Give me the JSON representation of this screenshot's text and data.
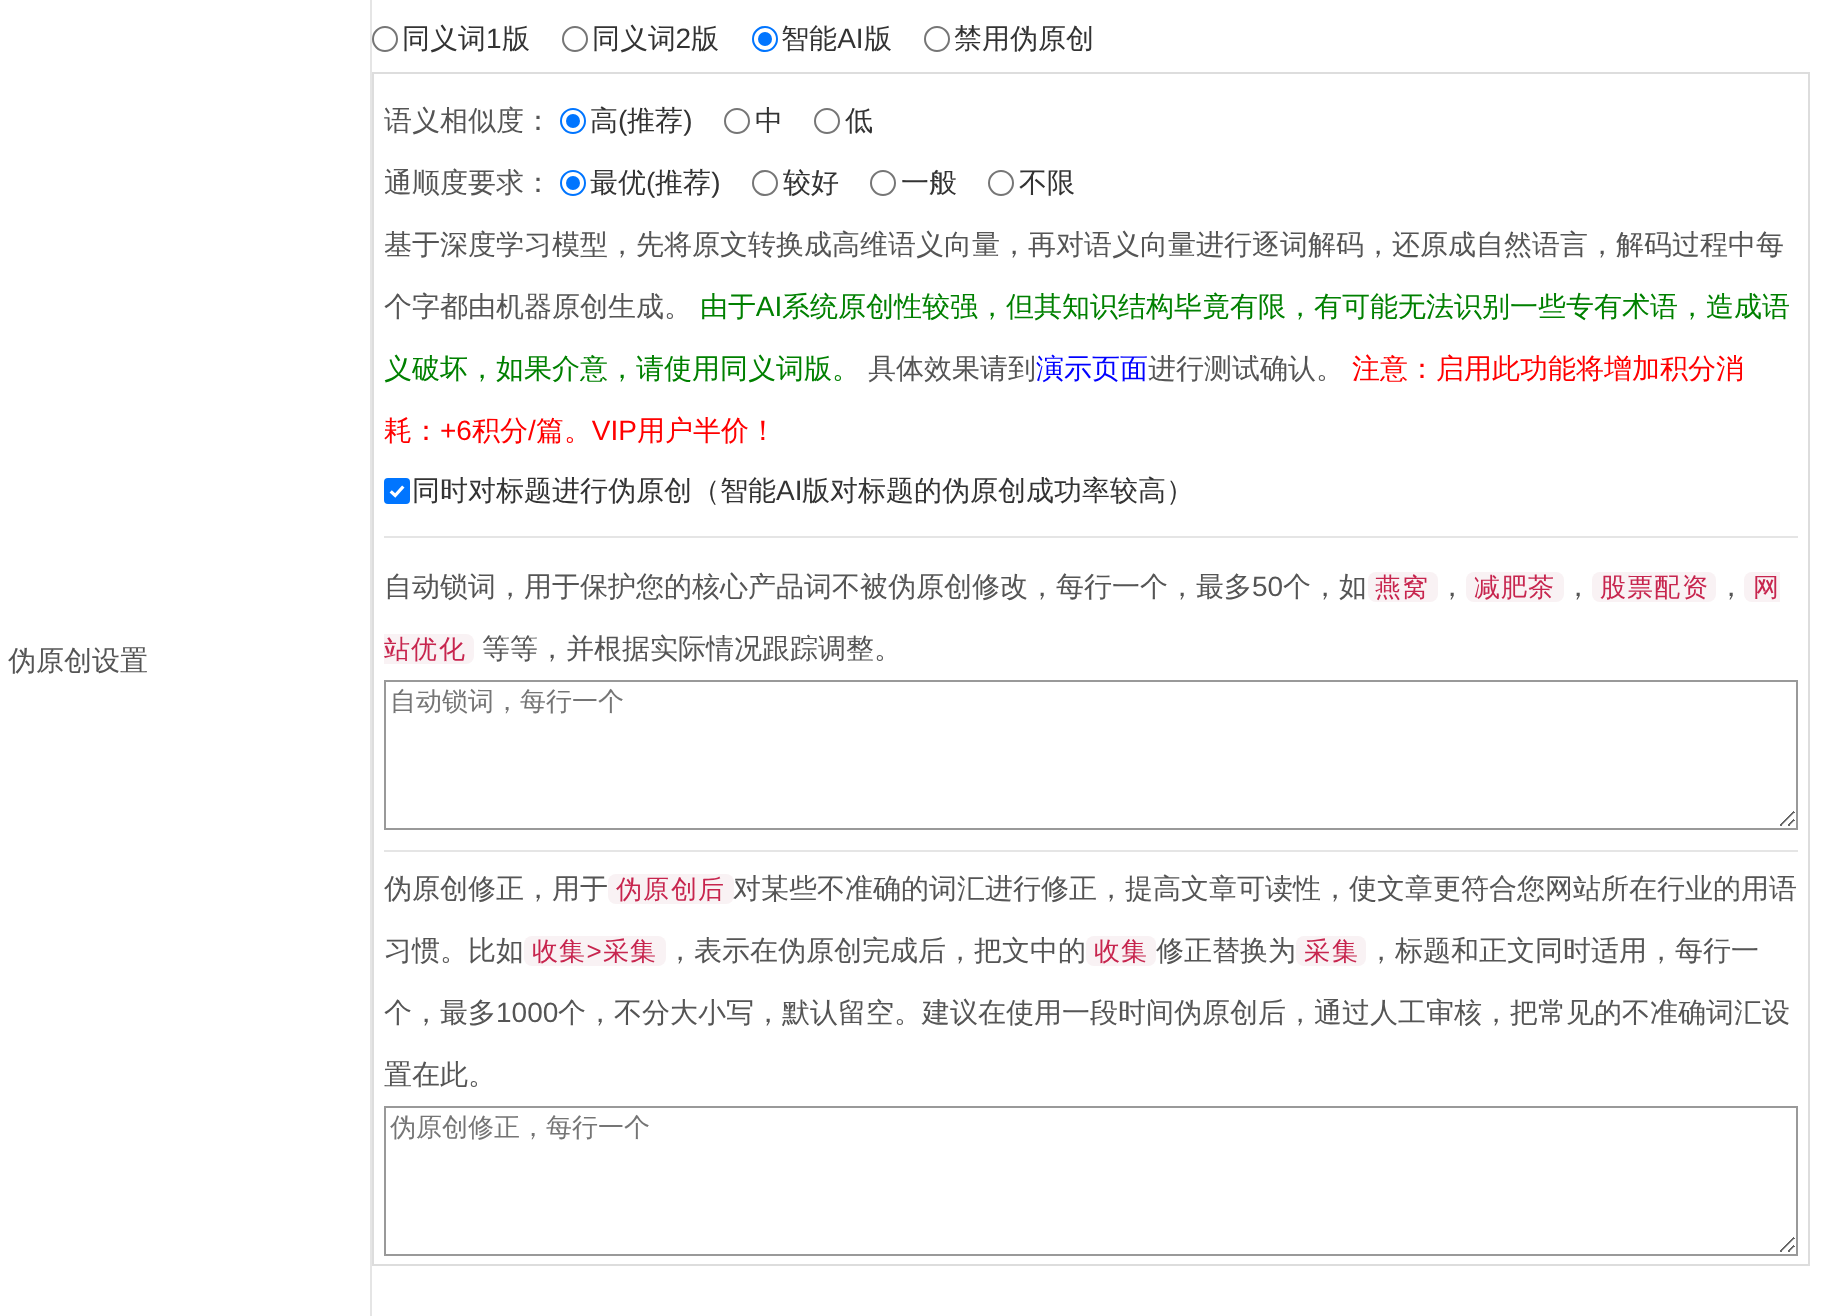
{
  "section_label": "伪原创设置",
  "modes": [
    {
      "label": "同义词1版",
      "selected": false
    },
    {
      "label": "同义词2版",
      "selected": false
    },
    {
      "label": "智能AI版",
      "selected": true
    },
    {
      "label": "禁用伪原创",
      "selected": false
    }
  ],
  "ai_panel": {
    "similarity": {
      "label": "语义相似度：",
      "options": [
        {
          "label": "高(推荐)",
          "selected": true
        },
        {
          "label": "中",
          "selected": false
        },
        {
          "label": "低",
          "selected": false
        }
      ]
    },
    "fluency": {
      "label": "通顺度要求：",
      "options": [
        {
          "label": "最优(推荐)",
          "selected": true
        },
        {
          "label": "较好",
          "selected": false
        },
        {
          "label": "一般",
          "selected": false
        },
        {
          "label": "不限",
          "selected": false
        }
      ]
    },
    "description": [
      {
        "kind": "text",
        "text": "基于深度学习模型，先将原文转换成高维语义向量，再对语义向量进行逐词解码，还原成自然语言，解码过程中每个字都由机器原创生成。 "
      },
      {
        "kind": "green",
        "text": "由于AI系统原创性较强，但其知识结构毕竟有限，有可能无法识别一些专有术语，造成语义破坏，如果介意，请使用同义词版。"
      },
      {
        "kind": "text",
        "text": " 具体效果请到"
      },
      {
        "kind": "link",
        "text": "演示页面"
      },
      {
        "kind": "text",
        "text": "进行测试确认。 "
      },
      {
        "kind": "red",
        "text": "注意：启用此功能将增加积分消耗：+6积分/篇。VIP用户半价！"
      }
    ],
    "title_rewrite": {
      "label": "同时对标题进行伪原创（智能AI版对标题的伪原创成功率较高）",
      "checked": true
    }
  },
  "lock_words": {
    "description": [
      {
        "kind": "text",
        "text": "自动锁词，用于保护您的核心产品词不被伪原创修改，每行一个，最多50个，如"
      },
      {
        "kind": "code",
        "text": "燕窝"
      },
      {
        "kind": "text",
        "text": "，"
      },
      {
        "kind": "code",
        "text": "减肥茶"
      },
      {
        "kind": "text",
        "text": "，"
      },
      {
        "kind": "code",
        "text": "股票配资"
      },
      {
        "kind": "text",
        "text": "，"
      },
      {
        "kind": "code",
        "text": "网站优化"
      },
      {
        "kind": "text",
        "text": " 等等，并根据实际情况跟踪调整。"
      }
    ],
    "placeholder": "自动锁词，每行一个"
  },
  "correction": {
    "description": [
      {
        "kind": "text",
        "text": "伪原创修正，用于"
      },
      {
        "kind": "code",
        "text": "伪原创后"
      },
      {
        "kind": "text",
        "text": "对某些不准确的词汇进行修正，提高文章可读性，使文章更符合您网站所在行业的用语习惯。比如"
      },
      {
        "kind": "code",
        "text": "收集>采集"
      },
      {
        "kind": "text",
        "text": "，表示在伪原创完成后，把文中的"
      },
      {
        "kind": "code",
        "text": "收集"
      },
      {
        "kind": "text",
        "text": "修正替换为"
      },
      {
        "kind": "code",
        "text": "采集"
      },
      {
        "kind": "text",
        "text": "，标题和正文同时适用，每行一个，最多1000个，不分大小写，默认留空。建议在使用一段时间伪原创后，通过人工审核，把常见的不准确词汇设置在此。"
      }
    ],
    "placeholder": "伪原创修正，每行一个"
  }
}
